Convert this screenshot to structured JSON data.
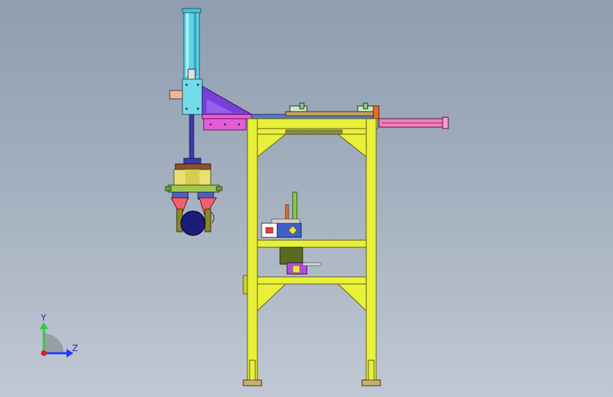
{
  "viewport": {
    "triad": {
      "y_label": "Y",
      "z_label": "Z"
    }
  },
  "colors": {
    "frame_yellow": "#e8f03a",
    "frame_edge": "#5a5a10",
    "cylinder_cyan": "#5fd3e6",
    "bracket_purple": "#7a3fd8",
    "beam_magenta": "#e85bd8",
    "gripper_pink": "#f06070",
    "gripper_olive": "#8a8a20",
    "part_navy": "#1c1c7a",
    "rail_pink": "#f080c0",
    "axis_y": "#2ecc40",
    "axis_z": "#1f3cff",
    "origin_red": "#e02020"
  },
  "icons": [
    "triad-icon"
  ]
}
